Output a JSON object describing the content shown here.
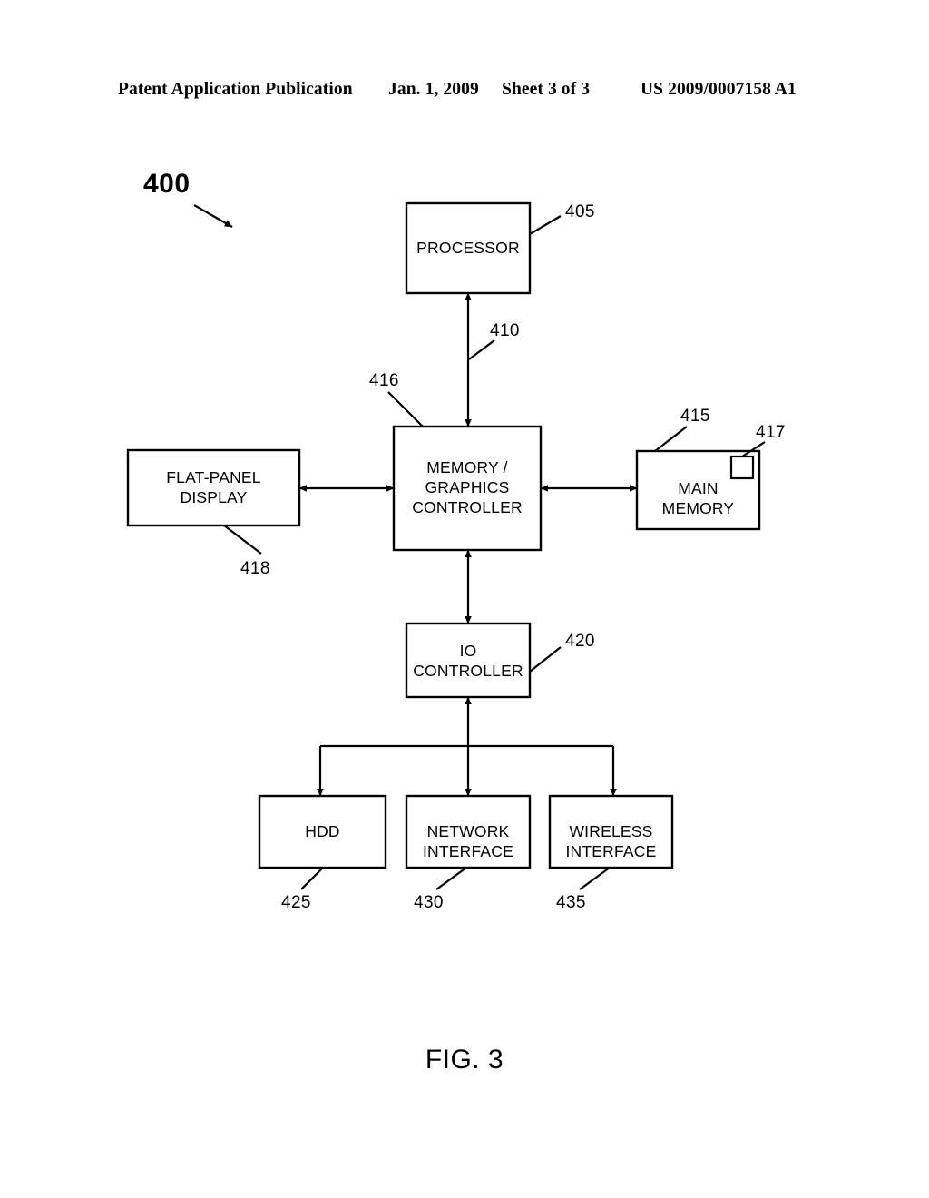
{
  "page_header": {
    "publication": "Patent Application Publication",
    "date": "Jan. 1, 2009",
    "sheet": "Sheet 3 of 3",
    "document_number": "US 2009/0007158 A1"
  },
  "figure": {
    "caption": "FIG. 3",
    "system_numeral": "400",
    "blocks": [
      {
        "id": "processor",
        "label": "PROCESSOR",
        "numeral": "405"
      },
      {
        "id": "memctl",
        "label": "MEMORY /\nGRAPHICS\nCONTROLLER",
        "numeral": "416"
      },
      {
        "id": "flatpanel",
        "label": "FLAT-PANEL\nDISPLAY",
        "numeral": "418"
      },
      {
        "id": "mainmem",
        "label": "MAIN\nMEMORY",
        "numeral": "415"
      },
      {
        "id": "mainmem_sub",
        "label": "",
        "numeral": "417"
      },
      {
        "id": "ioctl",
        "label": "IO\nCONTROLLER",
        "numeral": "420"
      },
      {
        "id": "hdd",
        "label": "HDD",
        "numeral": "425"
      },
      {
        "id": "network",
        "label": "NETWORK\nINTERFACE",
        "numeral": "430"
      },
      {
        "id": "wireless",
        "label": "WIRELESS\nINTERFACE",
        "numeral": "435"
      }
    ],
    "connections": [
      {
        "from": "memctl",
        "to": "processor",
        "numeral": "410",
        "style": "double-arrow-vertical"
      },
      {
        "from": "flatpanel",
        "to": "memctl",
        "numeral": "",
        "style": "double-arrow-horizontal"
      },
      {
        "from": "memctl",
        "to": "mainmem",
        "numeral": "",
        "style": "double-arrow-horizontal"
      },
      {
        "from": "memctl",
        "to": "ioctl",
        "numeral": "",
        "style": "double-arrow-vertical"
      },
      {
        "from": "ioctl",
        "to": "hdd",
        "numeral": "",
        "style": "bus-branch"
      },
      {
        "from": "ioctl",
        "to": "network",
        "numeral": "",
        "style": "bus-branch"
      },
      {
        "from": "ioctl",
        "to": "wireless",
        "numeral": "",
        "style": "bus-branch"
      }
    ]
  },
  "colors": {
    "ink": "#000000",
    "paper": "#ffffff"
  }
}
